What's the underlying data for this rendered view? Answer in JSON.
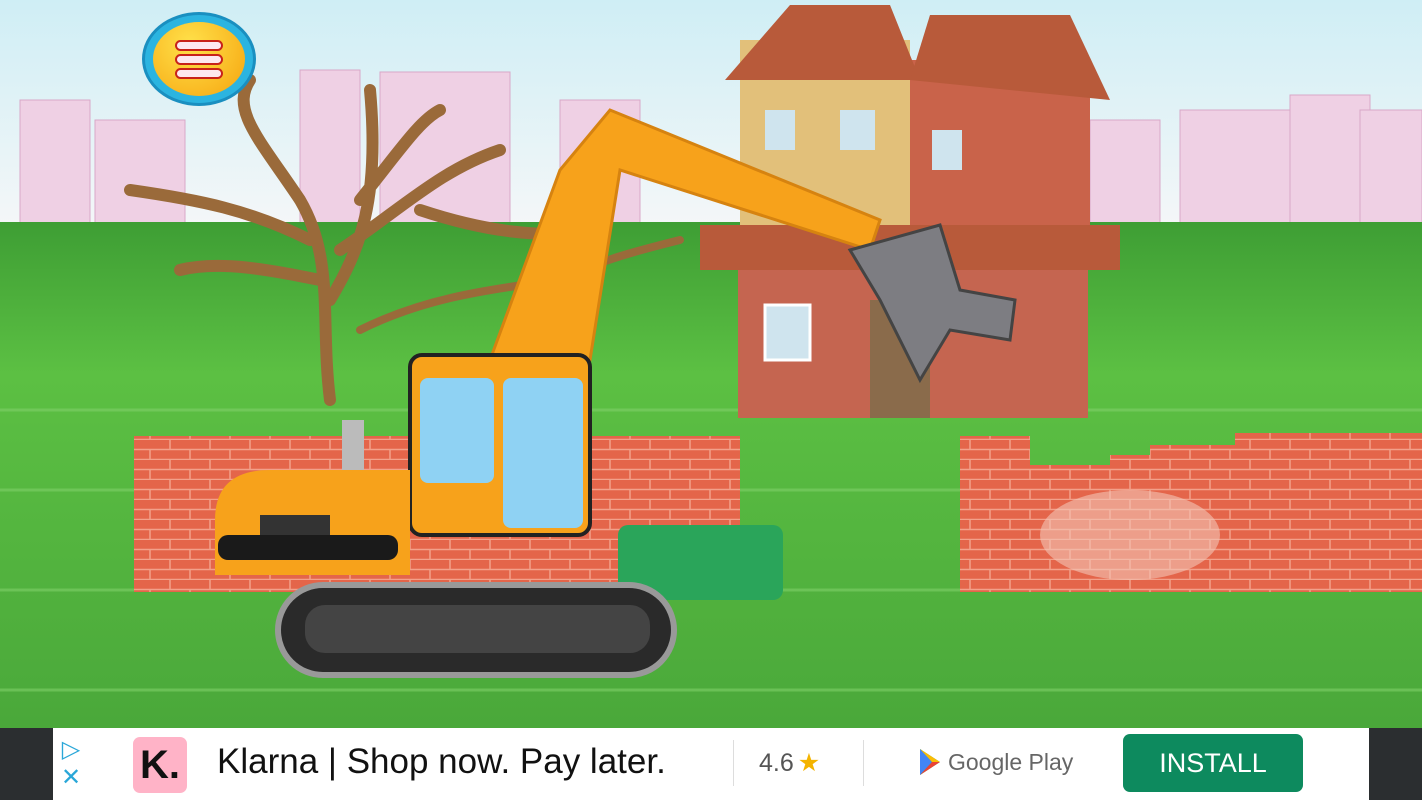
{
  "game": {
    "menu_icon": "hamburger-menu-icon",
    "scene": "excavator-demolition"
  },
  "ad": {
    "adchoices_icon": "adchoices-icon",
    "close_icon": "close-icon",
    "brand_logo_text": "K.",
    "headline": "Klarna | Shop now. Pay later.",
    "rating": "4.6",
    "rating_icon": "star-icon",
    "store_label": "Google Play",
    "install_label": "INSTALL"
  },
  "colors": {
    "grass": "#4fb23a",
    "brick": "#e4654a",
    "excavator": "#f7a21b",
    "install": "#0d8a5e"
  }
}
